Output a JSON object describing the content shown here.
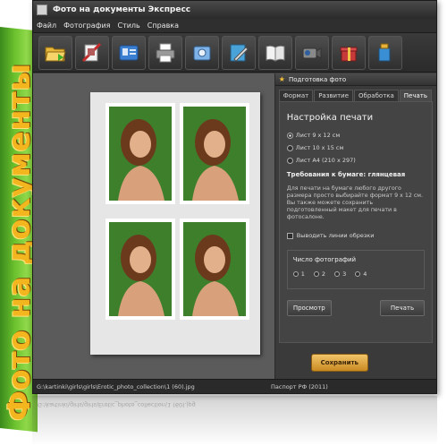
{
  "box_spine_text": "Фото на документы",
  "window": {
    "title": "Фото на документы Экспресс"
  },
  "menu": [
    "Файл",
    "Фотография",
    "Стиль",
    "Справка"
  ],
  "toolbar": {
    "icons": [
      "folder-open-icon",
      "crop-icon",
      "id-card-icon",
      "printer-icon",
      "photo-save-icon",
      "edit-pen-icon",
      "book-icon",
      "camcorder-icon",
      "gift-icon",
      "tools-icon"
    ]
  },
  "sheet": {
    "caption": ""
  },
  "panel": {
    "header": "Подготовка фото",
    "tabs": [
      "Формат",
      "Развитие",
      "Обработка",
      "Печать"
    ],
    "active_tab": "Печать",
    "title": "Настройка печати",
    "paper_options": [
      "Лист 9 x 12 см",
      "Лист 10 x 15 см",
      "Лист A4 (210 x 297)"
    ],
    "selected_paper": "Лист 9 x 12 см",
    "paper_req": "Требования к бумаге: глянцевая",
    "description": "Для печати на бумаге любого другого размера просто выбирайте формат 9 x 12 см. Вы также можете сохранить подготовленный макет для печати в фотосалоне.",
    "cut_lines_label": "Выводить линии обрезки",
    "photo_count_title": "Число фотографий",
    "photo_counts": [
      "1",
      "2",
      "3",
      "4"
    ],
    "preview_button": "Просмотр",
    "print_button": "Печать",
    "save_button": "Сохранить"
  },
  "status": {
    "path": "G:\\kartinki\\girls\\girls\\Erotic_photo_collection\\1 (60).jpg",
    "mode": "Паспорт РФ (2011)"
  },
  "colors": {
    "spine_green": "#6cc22e",
    "spine_text": "#f3b61e",
    "save_button": "#e0a23c",
    "photo_background": "#3e7f2c"
  }
}
